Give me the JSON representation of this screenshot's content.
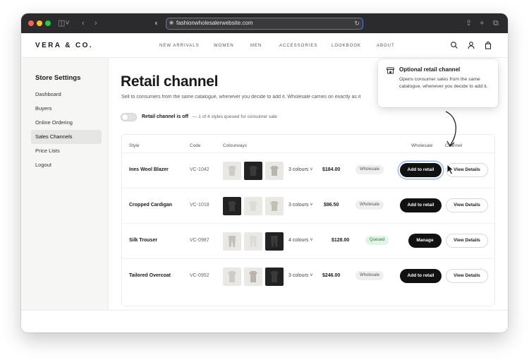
{
  "browser": {
    "url": "fashionwholesalerwebsite.com"
  },
  "site": {
    "logo": "VERA & CO.",
    "nav": [
      "NEW ARRIVALS",
      "WOMEN",
      "MEN",
      "ACCESSORIES",
      "LOOKBOOK",
      "ABOUT"
    ]
  },
  "sidebar": {
    "title": "Store Settings",
    "items": [
      {
        "label": "Dashboard"
      },
      {
        "label": "Buyers"
      },
      {
        "label": "Online Ordering"
      },
      {
        "label": "Sales Channels",
        "active": true
      },
      {
        "label": "Price Lists"
      },
      {
        "label": "Logout"
      }
    ]
  },
  "main": {
    "title": "Retail channel",
    "subtitle": "Sell to consumers from the same catalogue, whenever you decide to add it. Wholesale carries on exactly as it",
    "toggle_label": "Retail channel is off",
    "toggle_note": "— 1 of 4 styles queued for consumer sale"
  },
  "table": {
    "headers": {
      "style": "Style",
      "code": "Code",
      "colourways": "Colourways",
      "wholesale": "Wholesale",
      "channel": "Channel"
    },
    "rows": [
      {
        "style": "Ines Wool Blazer",
        "code": "VC-1042",
        "colours": "3 colours",
        "price": "$184.00",
        "status": "Wholesale",
        "action": "Add to retail",
        "details": "View Details"
      },
      {
        "style": "Cropped Cardigan",
        "code": "VC-1018",
        "colours": "3 colours",
        "price": "$96.50",
        "status": "Wholesale",
        "action": "Add to retail",
        "details": "View Details"
      },
      {
        "style": "Silk Trouser",
        "code": "VC-0987",
        "colours": "4 colours",
        "price": "$128.00",
        "status": "Queued",
        "action": "Manage",
        "details": "View Details"
      },
      {
        "style": "Tailored Overcoat",
        "code": "VC-0952",
        "colours": "3 colours",
        "price": "$246.00",
        "status": "Wholesale",
        "action": "Add to retail",
        "details": "View Details"
      }
    ]
  },
  "tooltip": {
    "title": "Optional retail channel",
    "body": "Opens consumer sales from the same catalogue, whenever you decide to add it."
  },
  "colors": {
    "accent": "#111111",
    "queued_bg": "#e2f4e5",
    "queued_text": "#2d7a3e",
    "focus_ring": "#9bb9ee"
  }
}
